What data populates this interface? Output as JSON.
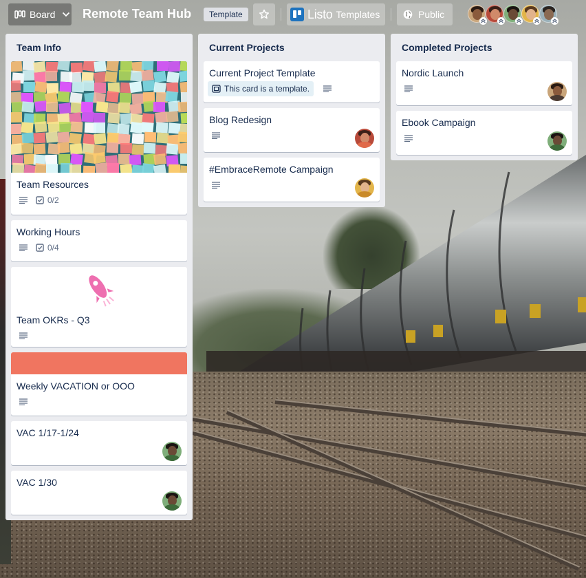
{
  "topbar": {
    "board_label": "Board",
    "board_title": "Remote Team Hub",
    "template_tag": "Template",
    "listo_name": "Listo",
    "listo_suffix": "Templates",
    "visibility": "Public",
    "members": [
      {
        "skin": "#8a5a3c",
        "hair": "#2a1a12",
        "bg": "#c9a57a"
      },
      {
        "skin": "#d08a6a",
        "hair": "#3a2018",
        "bg": "#b84a3a"
      },
      {
        "skin": "#6a4a36",
        "hair": "#1a1412",
        "bg": "#7fae7a"
      },
      {
        "skin": "#e2b38c",
        "hair": "#5a3a20",
        "bg": "#e3b54a"
      },
      {
        "skin": "#8a6a52",
        "hair": "#2a2420",
        "bg": "#9ab0b8"
      }
    ]
  },
  "lists": [
    {
      "title": "Team Info",
      "cards": [
        {
          "title": "Team Resources",
          "cover": "notes",
          "description": true,
          "checklist": "0/2"
        },
        {
          "title": "Working Hours",
          "description": true,
          "checklist": "0/4"
        },
        {
          "title": "Team OKRs - Q3",
          "cover": "rocket",
          "description": true
        },
        {
          "title": "Weekly VACATION or OOO",
          "cover": "color",
          "description": true
        },
        {
          "title": "VAC 1/17-1/24",
          "member": "m3"
        },
        {
          "title": "VAC 1/30",
          "member": "m3"
        }
      ]
    },
    {
      "title": "Current Projects",
      "cards": [
        {
          "title": "Current Project Template",
          "template_note": "This card is a template.",
          "description": true
        },
        {
          "title": "Blog Redesign",
          "description": true,
          "member": "m2"
        },
        {
          "title": "#EmbraceRemote Campaign",
          "description": true,
          "member": "m4"
        }
      ]
    },
    {
      "title": "Completed Projects",
      "cards": [
        {
          "title": "Nordic Launch",
          "description": true,
          "member": "m1"
        },
        {
          "title": "Ebook Campaign",
          "description": true,
          "member": "m3"
        }
      ]
    }
  ],
  "colors": {
    "list_bg": "#ebecf0",
    "card_text": "#172b4d",
    "badge_text": "#5e6c84",
    "vacation_cover": "#f07560",
    "rocket_pink": "#ee6fb0"
  },
  "icons": [
    "board-icon",
    "chevron-down-icon",
    "star-icon",
    "listo-logo-icon",
    "globe-icon",
    "description-icon",
    "checklist-icon",
    "template-card-icon",
    "rocket-sticker-icon"
  ]
}
